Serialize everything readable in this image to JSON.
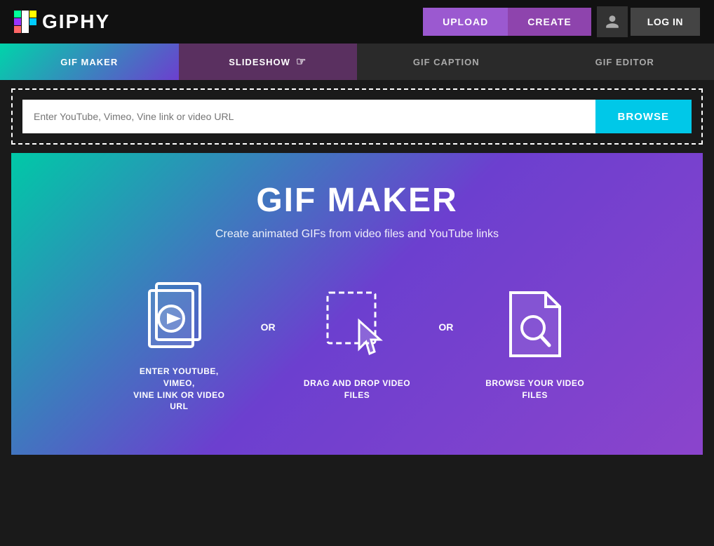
{
  "header": {
    "logo_text": "GIPHY",
    "upload_label": "UPLOAD",
    "create_label": "CREATE",
    "login_label": "LOG IN"
  },
  "tabs": [
    {
      "id": "gif-maker",
      "label": "GIF MAKER",
      "active": true
    },
    {
      "id": "slideshow",
      "label": "SLIDESHOW",
      "active": false
    },
    {
      "id": "gif-caption",
      "label": "GIF CAPTION",
      "active": false
    },
    {
      "id": "gif-editor",
      "label": "GIF EDITOR",
      "active": false
    }
  ],
  "upload_area": {
    "url_placeholder": "Enter YouTube, Vimeo, Vine link or video URL",
    "browse_label": "BROWSE"
  },
  "main": {
    "title": "GIF MAKER",
    "subtitle": "Create animated GIFs from video files and YouTube links",
    "step1_label": "ENTER YOUTUBE, VIMEO,\nVINE LINK OR VIDEO URL",
    "step2_label": "DRAG AND DROP VIDEO\nFILES",
    "step3_label": "BROWSE YOUR VIDEO FILES",
    "or1": "OR",
    "or2": "OR"
  },
  "colors": {
    "upload_purple": "#9b59d0",
    "create_purple": "#7d3dac",
    "browse_cyan": "#00c8e8",
    "tab_active_gradient_start": "#00d4aa",
    "tab_active_gradient_end": "#6c3fcf",
    "tab_slideshow": "#5a3060"
  }
}
